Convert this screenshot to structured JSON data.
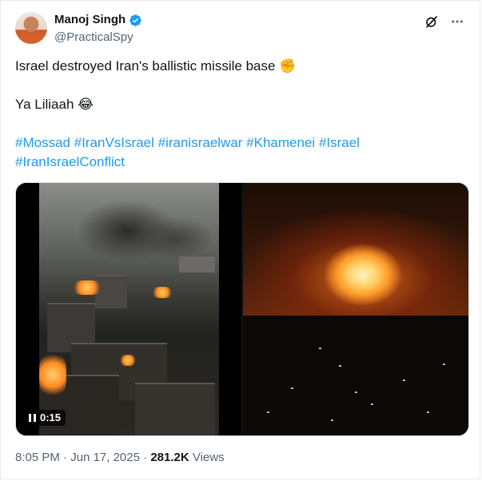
{
  "author": {
    "name": "Manoj Singh",
    "handle": "@PracticalSpy",
    "verified": true
  },
  "tweet": {
    "line1": "Israel destroyed Iran's ballistic missile base ✊",
    "line2": "Ya Liliaah 😂",
    "hashtags": [
      "#Mossad",
      "#IranVsIsrael",
      "#iranisraelwar",
      "#Khamenei",
      "#Israel",
      "#IranIsraelConflict"
    ]
  },
  "media": {
    "video_duration": "0:15",
    "state": "pause-icon"
  },
  "meta": {
    "time": "8:05 PM",
    "date": "Jun 17, 2025",
    "separator": "·",
    "views_count": "281.2K",
    "views_label": "Views"
  },
  "colors": {
    "link": "#1d9bf0",
    "verified": "#1d9bf0",
    "secondary_text": "#536471"
  },
  "icons": [
    "verified-badge-icon",
    "grok-icon",
    "more-icon",
    "pause-icon"
  ]
}
